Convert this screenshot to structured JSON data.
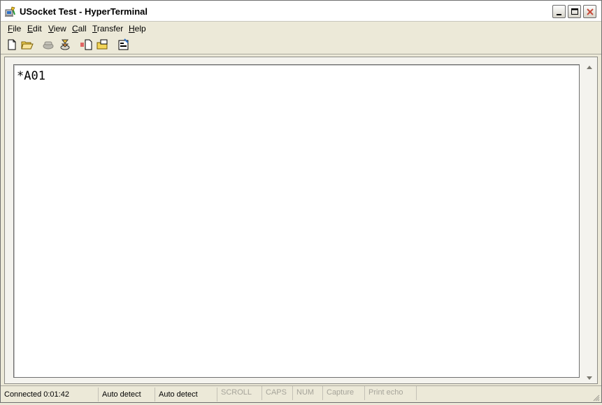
{
  "window": {
    "title": "USocket Test - HyperTerminal",
    "app_icon": "hyperterminal-icon",
    "controls": {
      "minimize": "minimize-icon",
      "maximize": "maximize-icon",
      "close": "close-icon"
    }
  },
  "menu": [
    {
      "acc": "F",
      "rest": "ile"
    },
    {
      "acc": "E",
      "rest": "dit"
    },
    {
      "acc": "V",
      "rest": "iew"
    },
    {
      "acc": "C",
      "rest": "all"
    },
    {
      "acc": "T",
      "rest": "ransfer"
    },
    {
      "acc": "H",
      "rest": "elp"
    }
  ],
  "toolbar": [
    "new-file-icon",
    "open-folder-icon",
    "connect-phone-icon",
    "disconnect-icon",
    "send-file-icon",
    "receive-file-icon",
    "properties-icon"
  ],
  "terminal": {
    "text": "*A01"
  },
  "status": [
    "Connected 0:01:42",
    "Auto detect",
    "Auto detect",
    "SCROLL",
    "CAPS",
    "NUM",
    "Capture",
    "Print echo"
  ],
  "colors": {
    "title_bar": "#ffffff",
    "chrome": "#ece9d8",
    "close_red": "#c74a3a",
    "disabled_text": "#a6a49a"
  }
}
